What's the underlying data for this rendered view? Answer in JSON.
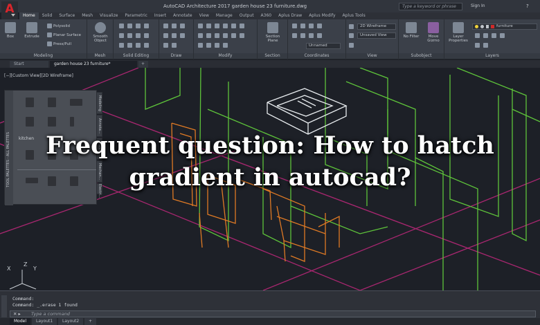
{
  "window": {
    "title": "AutoCAD Architecture 2017    garden house 23 furniture.dwg",
    "search_placeholder": "Type a keyword or phrase",
    "signin_label": "Sign In",
    "help_label": "?",
    "app_letter": "A"
  },
  "ribbon_tabs": [
    "Home",
    "Solid",
    "Surface",
    "Mesh",
    "Visualize",
    "Parametric",
    "Insert",
    "Annotate",
    "View",
    "Manage",
    "Output",
    "A360",
    "Aplus Draw",
    "Aplus Modify",
    "Aplus Tools"
  ],
  "ribbon_active_tab": "Home",
  "ribbon": {
    "modeling": {
      "label": "Modeling",
      "box": "Box",
      "extrude": "Extrude",
      "polysolid": "Polysolid",
      "planar_surface": "Planar Surface",
      "presspull": "Press/Pull"
    },
    "mesh": {
      "label": "Mesh",
      "smooth_object": "Smooth Object"
    },
    "solid_editing": {
      "label": "Solid Editing"
    },
    "draw": {
      "label": "Draw"
    },
    "modify": {
      "label": "Modify"
    },
    "section": {
      "label": "Section",
      "section_plane": "Section Plane"
    },
    "coordinates": {
      "label": "Coordinates",
      "unnamed": "Unnamed"
    },
    "view": {
      "label": "View",
      "visual_style": "2D Wireframe",
      "saved_view": "Unsaved View"
    },
    "subobject": {
      "label": "Subobject",
      "no_filter": "No Filter",
      "move_gizmo": "Move Gizmo"
    },
    "layers": {
      "label": "Layers",
      "layer_properties": "Layer Properties",
      "layer_name": "furniture"
    }
  },
  "doc_tabs": [
    "Start",
    "garden house 23 furniture*"
  ],
  "doc_active_tab": 1,
  "viewport": {
    "label": "[−][Custom View][2D Wireframe]"
  },
  "palette": {
    "category_label": "kitchen",
    "side_title": "TOOL PALETTES - ALL PALETTES",
    "tabs": [
      "Modeling",
      "Annota...",
      "Archite...",
      "Mechan...",
      "Electri...",
      "Civil"
    ]
  },
  "headline": "Frequent question: How to hatch gradient in autocad?",
  "ucs": {
    "x": "X",
    "y": "Y",
    "z": "Z"
  },
  "command_history": [
    "Command:",
    "Command: _.erase 1 found"
  ],
  "command_input_placeholder": "Type a command",
  "layout_tabs": [
    "Model",
    "Layout1",
    "Layout2",
    "+"
  ],
  "layout_active_tab": 0,
  "colors": {
    "background": "#1d2027",
    "ribbon": "#3b4049",
    "green_wire": "#5ec43a",
    "orange_wire": "#e07a24",
    "magenta_wire": "#c0287c",
    "white_wire": "#e8ecef"
  }
}
